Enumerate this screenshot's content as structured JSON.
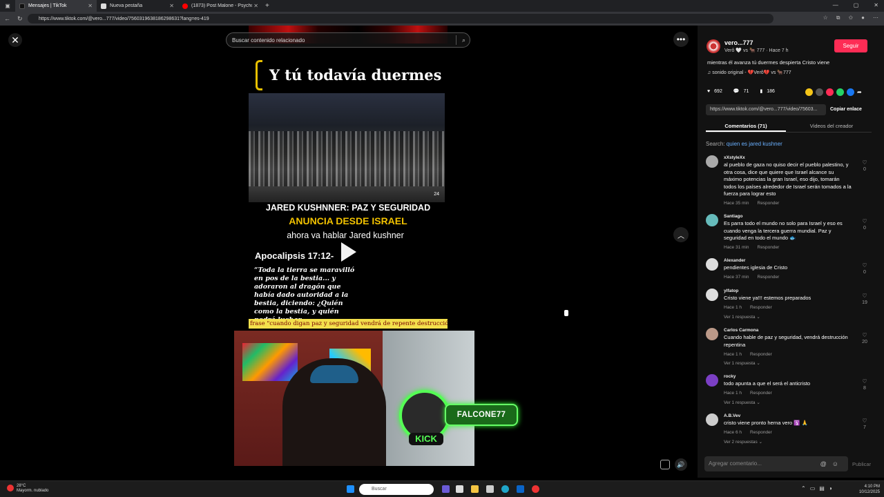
{
  "browser": {
    "tabs": [
      {
        "label": "Mensajes | TikTok",
        "favicon_color": "#111111"
      },
      {
        "label": "Nueva pestaña",
        "favicon_color": "#dddddd"
      },
      {
        "label": "(1873) Post Malone - Psycho (Of...",
        "favicon_color": "#ff0000"
      }
    ],
    "url": "https://www.tiktok.com/@vero...777/video/7560319638186298631?lang=es-419"
  },
  "search": {
    "placeholder": "Buscar contenido relacionado"
  },
  "video": {
    "headline": "Y tú todavía duermes",
    "news_badge": "24",
    "kushner_line": "JARED KUSHNNER:  PAZ Y SEGURIDAD",
    "anuncia_line": "ANUNCIA DESDE ISRAEL",
    "ahora_line": "ahora va hablar Jared kushner",
    "apocalipsis": "Apocalipsis 17:12-",
    "quote": "“Toda la tierra se maravilló en pos de la bestia... y adoraron al dragón que había dado autoridad a la bestia, diciendo: ¿Quién como la bestia, y quién podrá luchar",
    "ticker": "frase \"cuando digan paz y seguridad vendrá de repente destrucción repentina"
  },
  "overlay": {
    "streamer_name": "FALCONE77",
    "platform": "KICK"
  },
  "author": {
    "name": "vero...777",
    "subline": "Verô 🤍 vs 🐂 777 · Hace 7 h",
    "follow_label": "Seguir",
    "description": "mientras él avanza tú duermes despierta Cristo viene",
    "sound": "♫  sonido original - 💔Verô💔 vs 🐂777"
  },
  "stats": {
    "likes": "692",
    "comments": "71",
    "saves": "186"
  },
  "link": {
    "url": "https://www.tiktok.com/@vero...777/video/75603...",
    "copy_label": "Copiar enlace"
  },
  "panel_tabs": {
    "comments": "Comentarios (71)",
    "creator_videos": "Videos del creador"
  },
  "search_suggestion": {
    "prefix": "Search: ",
    "query": "quien es jared kushner"
  },
  "comments": [
    {
      "user": "xXstyleXx",
      "text": "al pueblo de gaza no quiso decir el pueblo palestino, y otra cosa, dice que quiere que Israel alcance su máximo potencias la gran Israel, eso dijo, tomarán todos los países alrededor de Israel serán tomados a la fuerza para lograr esto",
      "time": "Hace 35 min",
      "reply": "Responder",
      "likes": "0",
      "replies": ""
    },
    {
      "user": "Santiago",
      "text": "Es parra todo el mundo no solo para Israel y eso es cuando venga la tercera guerra mundial. Paz y seguridad en todo el mundo 🐟",
      "time": "Hace 31 min",
      "reply": "Responder",
      "likes": "0",
      "replies": ""
    },
    {
      "user": "Alexander",
      "text": "pendientes iglesia de Cristo",
      "time": "Hace 37 min",
      "reply": "Responder",
      "likes": "0",
      "replies": ""
    },
    {
      "user": "ylfatop",
      "text": "Cristo viene ya!!! estemos preparados",
      "time": "Hace 1 h",
      "reply": "Responder",
      "likes": "19",
      "replies": "Ver 1 respuesta ⌄"
    },
    {
      "user": "Carlos Carmona",
      "text": "Cuando hable de paz y seguridad, vendrá destrucción repentina",
      "time": "Hace 1 h",
      "reply": "Responder",
      "likes": "20",
      "replies": "Ver 1 respuesta ⌄"
    },
    {
      "user": "rocky",
      "text": "todo apunta a que el será el anticristo",
      "time": "Hace 1 h",
      "reply": "Responder",
      "likes": "8",
      "replies": "Ver 1 respuesta ⌄"
    },
    {
      "user": "A.B.Vev",
      "text": "cristo viene pronto herna vero 🛐 🙏",
      "time": "Hace 6 h",
      "reply": "Responder",
      "likes": "7",
      "replies": "Ver 2 respuestas ⌄"
    }
  ],
  "composer": {
    "placeholder": "Agregar comentario...",
    "publish_label": "Publicar"
  },
  "taskbar": {
    "weather_temp": "28°C",
    "weather_desc": "Mayorm. nublado",
    "search_placeholder": "Buscar",
    "time": "4:10 PM",
    "date": "10/12/2025"
  }
}
